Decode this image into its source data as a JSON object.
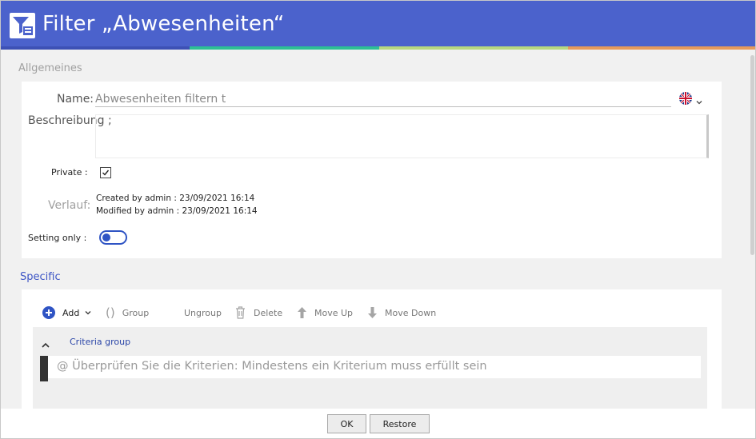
{
  "dialog": {
    "title": "Filter „Abwesenheiten“"
  },
  "general": {
    "section_title": "Allgemeines",
    "name_label": "Name:",
    "name_value": "Abwesenheiten filtern t",
    "description_label": "Beschreibung ;",
    "description_value": "",
    "private_label": "Private :",
    "private_checked": true,
    "history_label": "Verlauf:",
    "created_text": "Created by admin : 23/09/2021 16:14",
    "modified_text": "Modified by admin : 23/09/2021 16:14",
    "setting_only_label": "Setting only :",
    "setting_only_on": false
  },
  "specific": {
    "section_title": "Specific",
    "toolbar": {
      "add_label": "Add",
      "group_label": "Group",
      "ungroup_label": "Ungroup",
      "delete_label": "Delete",
      "move_up_label": "Move Up",
      "move_down_label": "Move Down"
    },
    "criteria_group_label": "Criteria group",
    "criteria_text": "@ Überprüfen Sie die Kriterien: Mindestens ein Kriterium muss erfüllt sein"
  },
  "footer": {
    "ok_label": "OK",
    "restore_label": "Restore"
  },
  "colors": {
    "header": "#4b62cc",
    "accent": "#3d55c5",
    "add_icon": "#2f54c4"
  }
}
